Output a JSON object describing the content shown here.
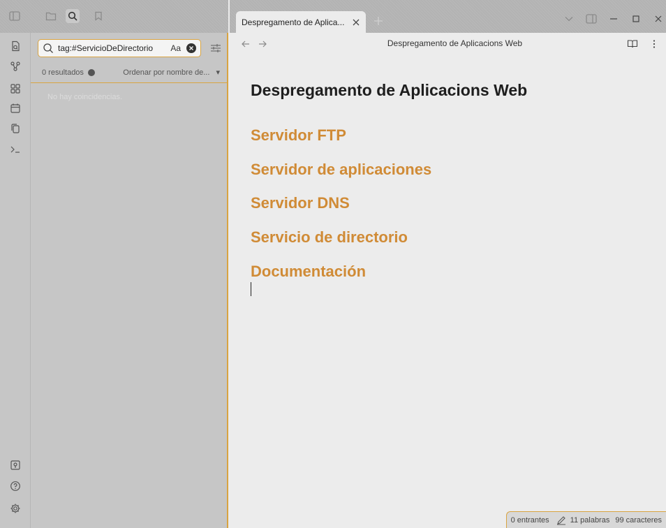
{
  "window": {
    "tab_title": "Despregamento de Aplica...",
    "new_tab_symbol": "+"
  },
  "search": {
    "query": "tag:#ServicioDeDirectorio",
    "match_case_label": "Aa",
    "result_count": "0 resultados",
    "sort_label": "Ordenar por nombre de...",
    "empty_message": "No hay coincidencias."
  },
  "editor": {
    "title_bar": "Despregamento de Aplicacions Web",
    "heading": "Despregamento de Aplicacions Web",
    "links": [
      "Servidor FTP",
      "Servidor de aplicaciones",
      "Servidor DNS",
      "Servicio de directorio",
      "Documentación"
    ]
  },
  "status": {
    "backlinks": "0 entrantes",
    "words": "11 palabras",
    "chars": "99 caracteres"
  },
  "colors": {
    "accent": "#d9a441",
    "link": "#d08b36",
    "panel_bg": "#c6c6c6",
    "editor_bg": "#ececec"
  },
  "icons": {
    "topbar": [
      "sidebar-toggle-icon",
      "folder-icon",
      "search-icon",
      "bookmark-icon"
    ],
    "ribbon": [
      "open-quick-switcher-icon",
      "graph-view-icon",
      "canvas-icon",
      "daily-note-icon",
      "templates-icon",
      "terminal-icon",
      "vault-switcher-icon",
      "help-icon",
      "settings-icon"
    ]
  }
}
